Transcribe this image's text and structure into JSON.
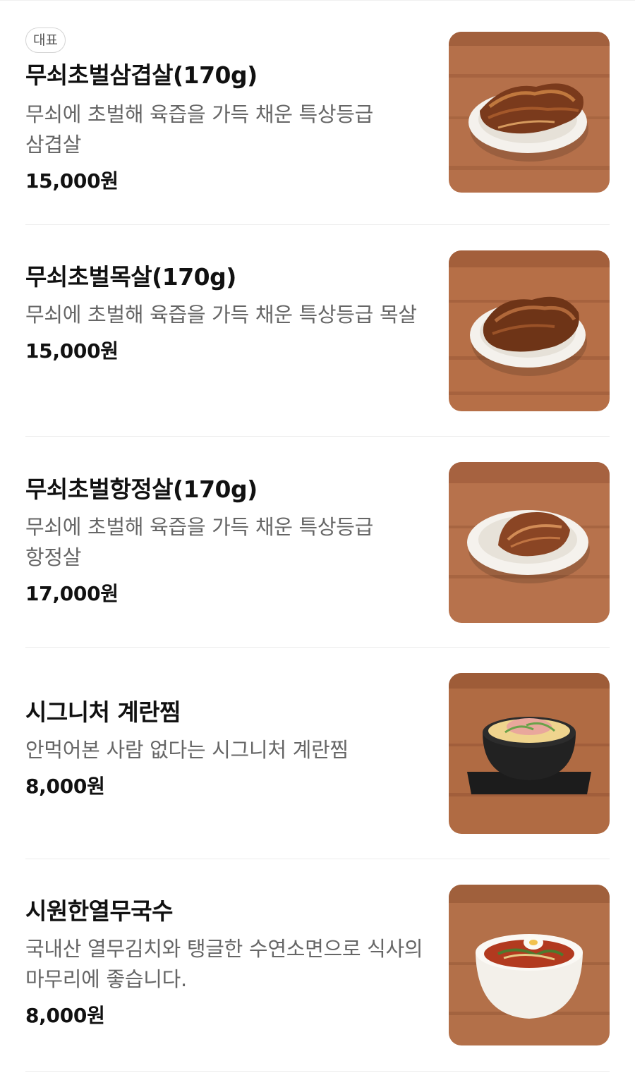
{
  "menu": {
    "items": [
      {
        "badge": "대표",
        "name": "무쇠초벌삼겹살(170g)",
        "desc": "무쇠에 초벌해 육즙을 가득 채운 특상등급 삼겹살",
        "price": "15,000원",
        "image": "grilled-pork-belly-photo"
      },
      {
        "name": "무쇠초벌목살(170g)",
        "desc": "무쇠에 초벌해 육즙을 가득 채운 특상등급 목살",
        "price": "15,000원",
        "image": "grilled-pork-neck-photo"
      },
      {
        "name": "무쇠초벌항정살(170g)",
        "desc": "무쇠에 초벌해 육즙을 가득 채운 특상등급 항정살",
        "price": "17,000원",
        "image": "grilled-pork-jowl-photo"
      },
      {
        "name": "시그니처 계란찜",
        "desc": "안먹어본 사람 없다는 시그니처 계란찜",
        "price": "8,000원",
        "image": "steamed-egg-photo"
      },
      {
        "name": "시원한열무국수",
        "desc": "국내산 열무김치와 탱글한 수연소면으로 식사의 마무리에 좋습니다.",
        "price": "8,000원",
        "image": "young-radish-noodles-photo"
      }
    ]
  },
  "colors": {
    "title": "#111111",
    "description": "#666666",
    "divider": "#ececec",
    "wood": "#b5704a"
  }
}
